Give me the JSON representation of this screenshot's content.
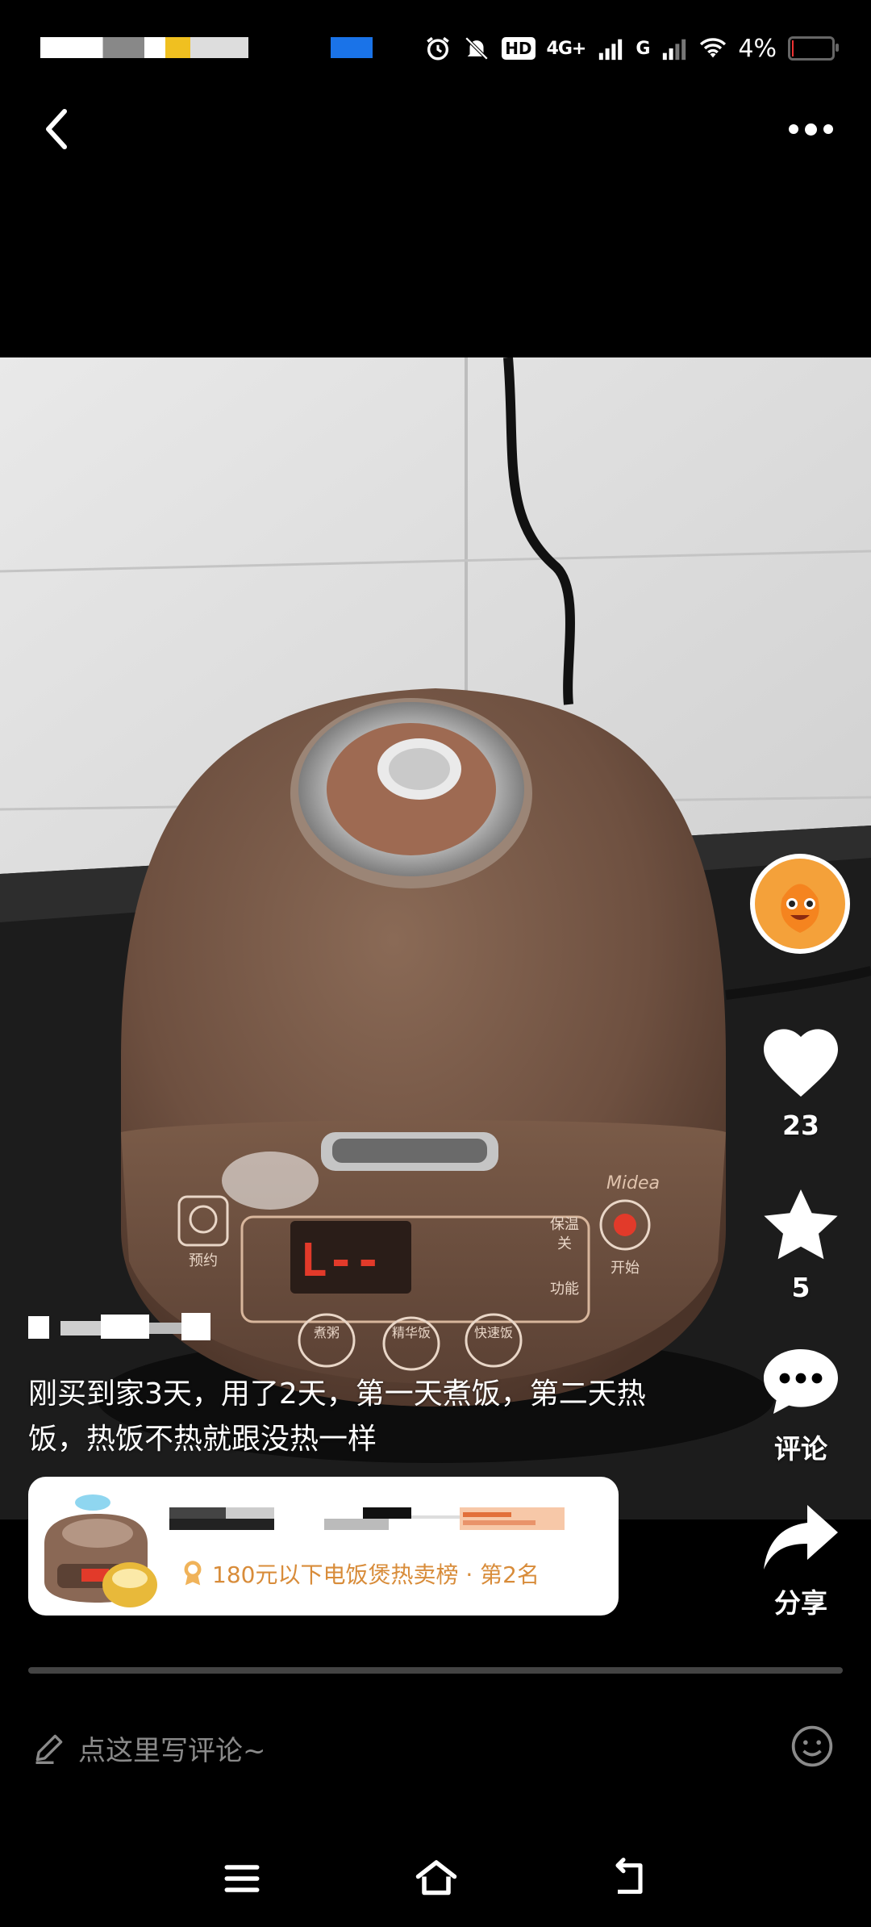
{
  "status_bar": {
    "battery_percent": "4%",
    "signal_primary": "4G+",
    "signal_secondary": "G",
    "hd_label": "HD"
  },
  "header": {
    "back_icon": "chevron-left-icon",
    "more_icon": "more-dots-icon"
  },
  "actions": {
    "like_count": "23",
    "favorite_count": "5",
    "comment_label": "评论",
    "share_label": "分享"
  },
  "post": {
    "caption": "刚买到家3天，用了2天，第一天煮饭，第二天热饭，热饭不热就跟没热一样",
    "product_photo_text": {
      "brand": "Midea",
      "preset_label": "预约",
      "start_label": "开始",
      "keep_warm_label": "保温",
      "off_label": "关",
      "function_label": "功能",
      "porridge_label": "煮粥",
      "fine_rice_label": "精华饭",
      "quick_rice_label": "快速饭"
    }
  },
  "product_card": {
    "ranking_text": "180元以下电饭煲热卖榜 · 第2名"
  },
  "comment_bar": {
    "placeholder": "点这里写评论~"
  },
  "colors": {
    "background": "#000000",
    "ranking_text": "#d88c3a",
    "like_icon": "#ffffff",
    "avatar_orange": "#f5841f"
  }
}
